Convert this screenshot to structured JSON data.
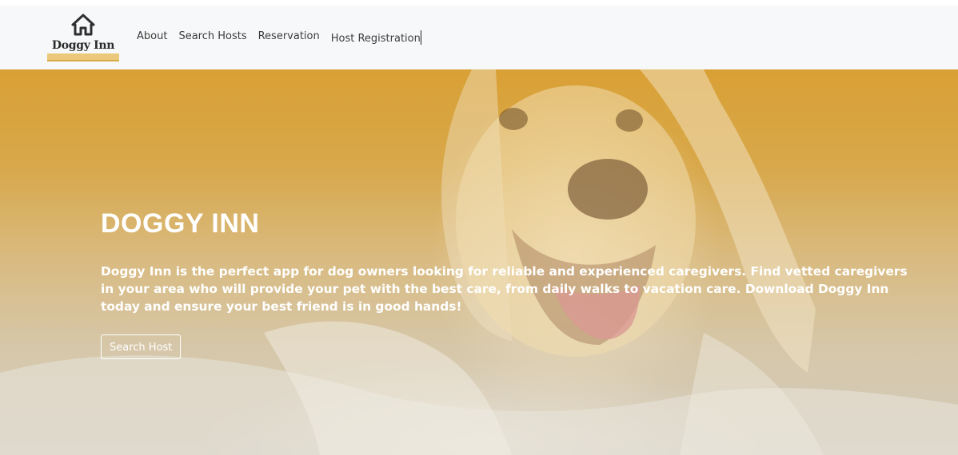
{
  "brand": {
    "name": "Doggy Inn",
    "icon": "house-icon",
    "accent_color": "#ecc97a"
  },
  "nav": {
    "items": [
      {
        "label": "About"
      },
      {
        "label": "Search Hosts"
      },
      {
        "label": "Reservation"
      },
      {
        "label": "Host Registration"
      }
    ]
  },
  "hero": {
    "title": "DOGGY INN",
    "description": "Doggy Inn is the perfect app for dog owners looking for reliable and experienced caregivers. Find vetted caregivers in your area who will provide your pet with the best care, from daily walks to vacation care. Download Doggy Inn today and ensure your best friend is in good hands!",
    "button_label": "Search Host",
    "background_image": "dog-under-blanket-photo",
    "overlay_color": "#d9a035"
  }
}
